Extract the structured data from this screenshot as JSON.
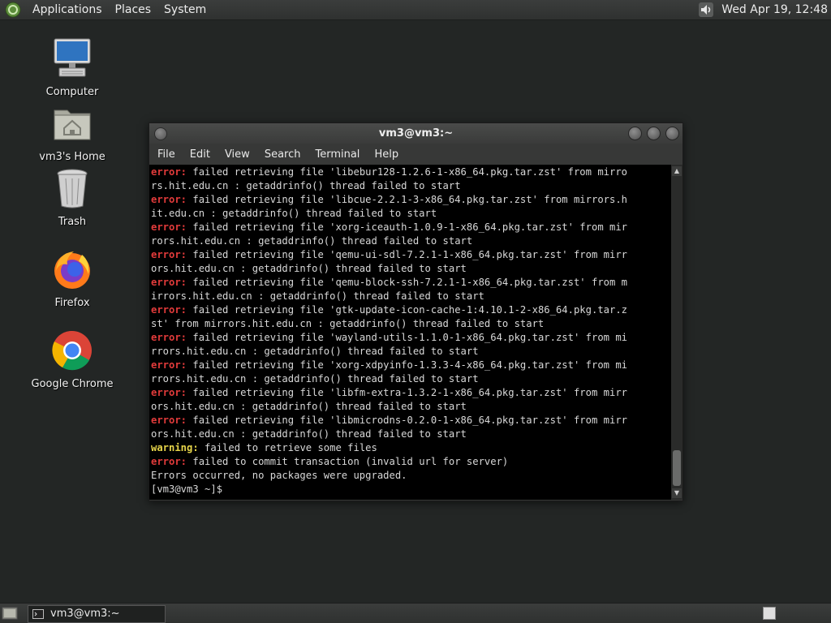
{
  "top_panel": {
    "menus": [
      "Applications",
      "Places",
      "System"
    ],
    "clock": "Wed Apr 19, 12:48"
  },
  "desktop_icons": [
    {
      "label": "Computer",
      "icon": "computer-icon"
    },
    {
      "label": "vm3's Home",
      "icon": "home-folder-icon"
    },
    {
      "label": "Trash",
      "icon": "trash-icon"
    },
    {
      "label": "Firefox",
      "icon": "firefox-icon"
    },
    {
      "label": "Google Chrome",
      "icon": "chrome-icon"
    }
  ],
  "window": {
    "title": "vm3@vm3:~",
    "menus": [
      "File",
      "Edit",
      "View",
      "Search",
      "Terminal",
      "Help"
    ]
  },
  "terminal": {
    "lines": [
      {
        "kw": "error",
        "text": " failed retrieving file 'libebur128-1.2.6-1-x86_64.pkg.tar.zst' from mirro"
      },
      {
        "kw": "",
        "text": "rs.hit.edu.cn : getaddrinfo() thread failed to start"
      },
      {
        "kw": "error",
        "text": " failed retrieving file 'libcue-2.2.1-3-x86_64.pkg.tar.zst' from mirrors.h"
      },
      {
        "kw": "",
        "text": "it.edu.cn : getaddrinfo() thread failed to start"
      },
      {
        "kw": "error",
        "text": " failed retrieving file 'xorg-iceauth-1.0.9-1-x86_64.pkg.tar.zst' from mir"
      },
      {
        "kw": "",
        "text": "rors.hit.edu.cn : getaddrinfo() thread failed to start"
      },
      {
        "kw": "error",
        "text": " failed retrieving file 'qemu-ui-sdl-7.2.1-1-x86_64.pkg.tar.zst' from mirr"
      },
      {
        "kw": "",
        "text": "ors.hit.edu.cn : getaddrinfo() thread failed to start"
      },
      {
        "kw": "error",
        "text": " failed retrieving file 'qemu-block-ssh-7.2.1-1-x86_64.pkg.tar.zst' from m"
      },
      {
        "kw": "",
        "text": "irrors.hit.edu.cn : getaddrinfo() thread failed to start"
      },
      {
        "kw": "error",
        "text": " failed retrieving file 'gtk-update-icon-cache-1:4.10.1-2-x86_64.pkg.tar.z"
      },
      {
        "kw": "",
        "text": "st' from mirrors.hit.edu.cn : getaddrinfo() thread failed to start"
      },
      {
        "kw": "error",
        "text": " failed retrieving file 'wayland-utils-1.1.0-1-x86_64.pkg.tar.zst' from mi"
      },
      {
        "kw": "",
        "text": "rrors.hit.edu.cn : getaddrinfo() thread failed to start"
      },
      {
        "kw": "error",
        "text": " failed retrieving file 'xorg-xdpyinfo-1.3.3-4-x86_64.pkg.tar.zst' from mi"
      },
      {
        "kw": "",
        "text": "rrors.hit.edu.cn : getaddrinfo() thread failed to start"
      },
      {
        "kw": "error",
        "text": " failed retrieving file 'libfm-extra-1.3.2-1-x86_64.pkg.tar.zst' from mirr"
      },
      {
        "kw": "",
        "text": "ors.hit.edu.cn : getaddrinfo() thread failed to start"
      },
      {
        "kw": "error",
        "text": " failed retrieving file 'libmicrodns-0.2.0-1-x86_64.pkg.tar.zst' from mirr"
      },
      {
        "kw": "",
        "text": "ors.hit.edu.cn : getaddrinfo() thread failed to start"
      },
      {
        "kw": "warning",
        "text": " failed to retrieve some files"
      },
      {
        "kw": "error",
        "text": " failed to commit transaction (invalid url for server)"
      },
      {
        "kw": "",
        "text": "Errors occurred, no packages were upgraded."
      },
      {
        "kw": "",
        "text": "[vm3@vm3 ~]$ "
      }
    ],
    "keyword_labels": {
      "error": "error:",
      "warning": "warning:"
    }
  },
  "taskbar": {
    "task_title": "vm3@vm3:~"
  },
  "colors": {
    "error": "#e23b3b",
    "warning": "#e6d44a",
    "terminal_bg": "#000000",
    "desktop_bg": "#232625"
  }
}
